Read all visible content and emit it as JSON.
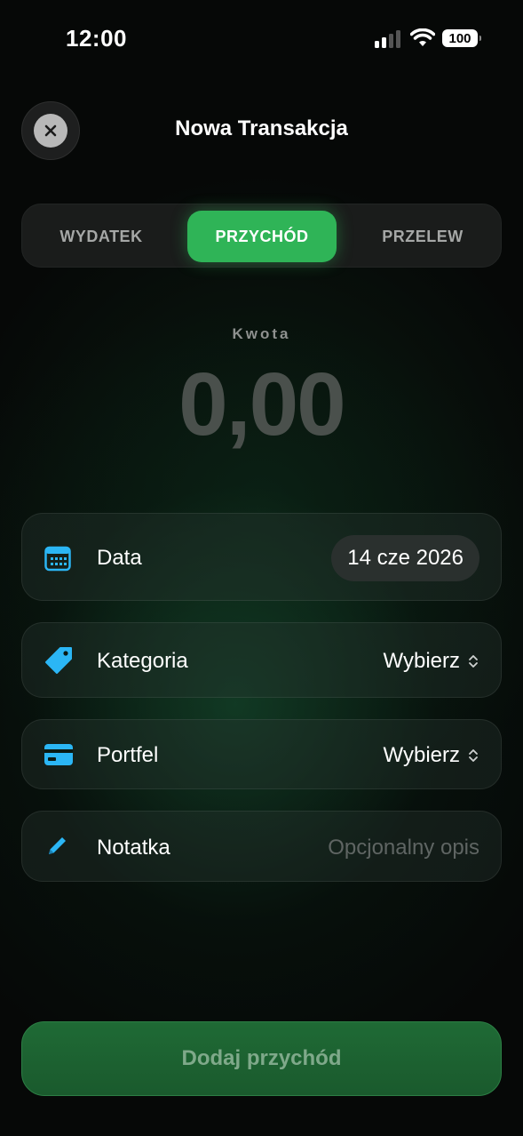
{
  "status_bar": {
    "time": "12:00",
    "battery": "100",
    "signal_bars_active": 2,
    "signal_bars_total": 4
  },
  "header": {
    "title": "Nowa Transakcja",
    "close_icon": "close-icon"
  },
  "segments": [
    {
      "label": "WYDATEK",
      "active": false
    },
    {
      "label": "PRZYCHÓD",
      "active": true
    },
    {
      "label": "PRZELEW",
      "active": false
    }
  ],
  "amount": {
    "label": "Kwota",
    "value": "0,00"
  },
  "fields": {
    "date": {
      "icon": "calendar-icon",
      "label": "Data",
      "value": "14 cze 2026"
    },
    "category": {
      "icon": "tag-icon",
      "label": "Kategoria",
      "value": "Wybierz"
    },
    "wallet": {
      "icon": "credit-card-icon",
      "label": "Portfel",
      "value": "Wybierz"
    },
    "note": {
      "icon": "pencil-icon",
      "label": "Notatka",
      "placeholder": "Opcjonalny opis"
    }
  },
  "submit": {
    "label": "Dodaj przychód"
  },
  "colors": {
    "accent": "#2fb457",
    "icon_blue": "#2bb6f5",
    "submit_bg": "#1f6a35"
  }
}
